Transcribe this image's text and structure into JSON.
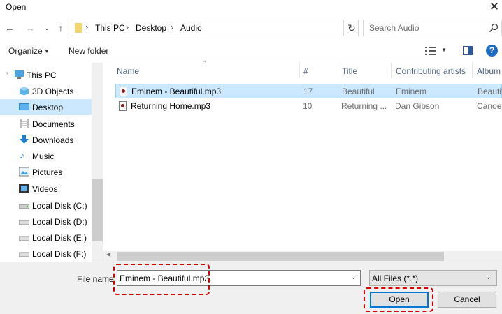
{
  "window": {
    "title": "Open",
    "close_glyph": "✕"
  },
  "address": {
    "crumbs": [
      "This PC",
      "Desktop",
      "Audio"
    ],
    "search_placeholder": "Search Audio"
  },
  "toolbar": {
    "organize": "Organize",
    "new_folder": "New folder",
    "help": "?"
  },
  "nav": {
    "items": [
      {
        "label": "This PC",
        "icon": "pc-icon"
      },
      {
        "label": "3D Objects",
        "icon": "cube-icon"
      },
      {
        "label": "Desktop",
        "icon": "desktop-icon",
        "selected": true
      },
      {
        "label": "Documents",
        "icon": "document-icon"
      },
      {
        "label": "Downloads",
        "icon": "download-icon"
      },
      {
        "label": "Music",
        "icon": "music-icon"
      },
      {
        "label": "Pictures",
        "icon": "pictures-icon"
      },
      {
        "label": "Videos",
        "icon": "videos-icon"
      },
      {
        "label": "Local Disk (C:)",
        "icon": "disk-icon"
      },
      {
        "label": "Local Disk (D:)",
        "icon": "disk-icon"
      },
      {
        "label": "Local Disk (E:)",
        "icon": "disk-icon"
      },
      {
        "label": "Local Disk (F:)",
        "icon": "disk-icon"
      }
    ]
  },
  "files": {
    "columns": [
      "Name",
      "#",
      "Title",
      "Contributing artists",
      "Album"
    ],
    "rows": [
      {
        "name": "Eminem - Beautiful.mp3",
        "num": "17",
        "title": "Beautiful",
        "artist": "Eminem",
        "album": "Beautiful",
        "selected": true
      },
      {
        "name": "Returning Home.mp3",
        "num": "10",
        "title": "Returning ...",
        "artist": "Dan Gibson",
        "album": "Canoe"
      }
    ]
  },
  "bottom": {
    "file_name_label": "File name:",
    "file_name_value": "Eminem - Beautiful.mp3",
    "file_type": "All Files (*.*)",
    "open": "Open",
    "cancel": "Cancel"
  },
  "colors": {
    "selection": "#cce8ff",
    "accent": "#0078d7",
    "highlight": "#d40000"
  }
}
